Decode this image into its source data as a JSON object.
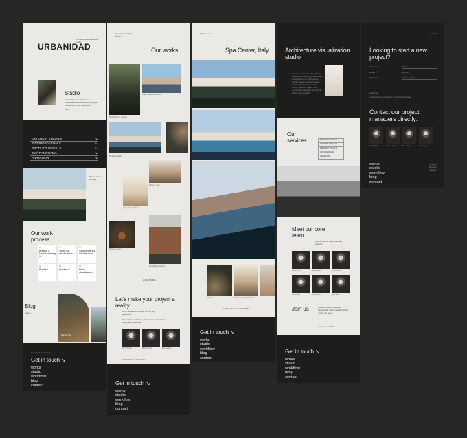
{
  "col1": {
    "logo": "URBANIDAD",
    "header_meta": "Architecture visualization studio",
    "studio_title": "Studio",
    "studio_text": "Urbanidad is an architecture visualization studio creating images for architects and developers",
    "more_link": "more →",
    "services": [
      "EXTERIOR VISUALS",
      "INTERIOR VISUALS",
      "PRODUCT VISUALS",
      "360° PANORAMA",
      "ANIMATION"
    ],
    "arrow": "↘",
    "hero_caption": "Private house, Norway",
    "process_title": "Our work process",
    "process_steps": [
      {
        "n": "01",
        "label": "Briefing & kickoff meeting 1"
      },
      {
        "n": "02",
        "label": "Views for visualization"
      },
      {
        "n": "03",
        "label": "Clay renders & moodboards"
      },
      {
        "n": "04",
        "label": "Preview 1"
      },
      {
        "n": "05",
        "label": "Preview 2"
      },
      {
        "n": "06",
        "label": "Final visualization"
      }
    ],
    "blog_title": "Blog",
    "blog_more": "more →",
    "blog_post": "Forest villa",
    "contact_title": "Get in touch ↘",
    "contact_meta": "hello@urbanidad.com",
    "menu": [
      "works",
      "studio",
      "workflow",
      "blog",
      "contact"
    ]
  },
  "col2": {
    "top_meta": "The Urban Design studio",
    "title": "Our works",
    "works": [
      {
        "caption": "Private house, Norway",
        "year": "2023"
      },
      {
        "caption": "Lake house, Switzerland",
        "year": "2023"
      },
      {
        "caption": "Pool villa, Spain",
        "year": "2023"
      },
      {
        "caption": "Kitchen, Oslo",
        "year": "2023"
      },
      {
        "caption": "Living space, Bergen",
        "year": "2022"
      },
      {
        "caption": "Product, serum",
        "year": "2022"
      },
      {
        "caption": "Residential complex",
        "year": "2022"
      }
    ],
    "load_more": "LOAD MORE ↓",
    "cta_title": "Let's make your project a reality!",
    "cta_text": "Don't hesitate to contact us with any questions.",
    "cta_small": "We work for architects, developers and interior designers worldwide",
    "team": [
      {
        "name": "Anna Smith"
      },
      {
        "name": "Maria Lopez"
      },
      {
        "name": "Eva Larsen"
      }
    ],
    "cta_link": "SCHEDULE A MEETING ↘",
    "contact_title": "Get in touch ↘",
    "menu": [
      "works",
      "studio",
      "workflow",
      "blog",
      "contact"
    ]
  },
  "col3": {
    "top_meta": "Private house",
    "title": "Spa Center, Italy",
    "thumbs": [
      {
        "caption": "Terrace"
      },
      {
        "caption": "Restaurant, Magna Grecia"
      },
      {
        "caption": "Interior"
      }
    ],
    "back_link": "GO BACK TO ALL WORKS ↘",
    "contact_title": "Get in touch ↘",
    "menu": [
      "works",
      "studio",
      "workflow",
      "blog",
      "contact"
    ]
  },
  "col4": {
    "title": "Architecture visualization studio",
    "body": "We are a team of architects and 3D artists producing photorealistic visualizations for architecture, interior design and real estate marketing. Our images help clients present projects, win competitions and sell properties before they are built.",
    "services_title": "Our services",
    "services": [
      "EXTERIOR VISUALS",
      "INTERIOR VISUALS",
      "PRODUCT VISUALS",
      "360° PANORAMA",
      "ANIMATION"
    ],
    "team_title": "Meet our core team",
    "team_text": "People behind the Urbanidad projects",
    "team": [
      {
        "name": "Anna Smith"
      },
      {
        "name": "Maria Lopez"
      },
      {
        "name": "Eva Larsen"
      },
      {
        "name": "Lena Berg"
      },
      {
        "name": "Tom Meyer"
      },
      {
        "name": "Alex Moor"
      }
    ],
    "join_title": "Join us",
    "join_text": "We are always looking for talented 3D artists and architects to join our team.",
    "join_link": "send your portfolio →",
    "contact_title": "Get in touch ↘",
    "menu": [
      "works",
      "studio",
      "workflow",
      "blog",
      "contact"
    ]
  },
  "col5": {
    "top_meta": "Contact",
    "title": "Looking to start a new project?",
    "fields": [
      {
        "label": "Your name",
        "placeholder": "Name"
      },
      {
        "label": "Email",
        "placeholder": "E-mail"
      },
      {
        "label": "Message",
        "placeholder": "About project"
      }
    ],
    "attach": "Attach file",
    "consent": "I agree to the processing of my personal data",
    "managers_title": "Contact our project managers directly:",
    "managers": [
      {
        "name": "Anna Smith"
      },
      {
        "name": "Maria Lopez"
      },
      {
        "name": "Eva Larsen"
      },
      {
        "name": "Lena Berg"
      }
    ],
    "menu": [
      "works",
      "studio",
      "workflow",
      "blog",
      "contact"
    ],
    "social": "Instagram Behance LinkedIn"
  },
  "colors": {
    "background": "#262624",
    "light": "#ebe9e5",
    "dark": "#1d1d1c",
    "text": "#1b1b1b"
  }
}
